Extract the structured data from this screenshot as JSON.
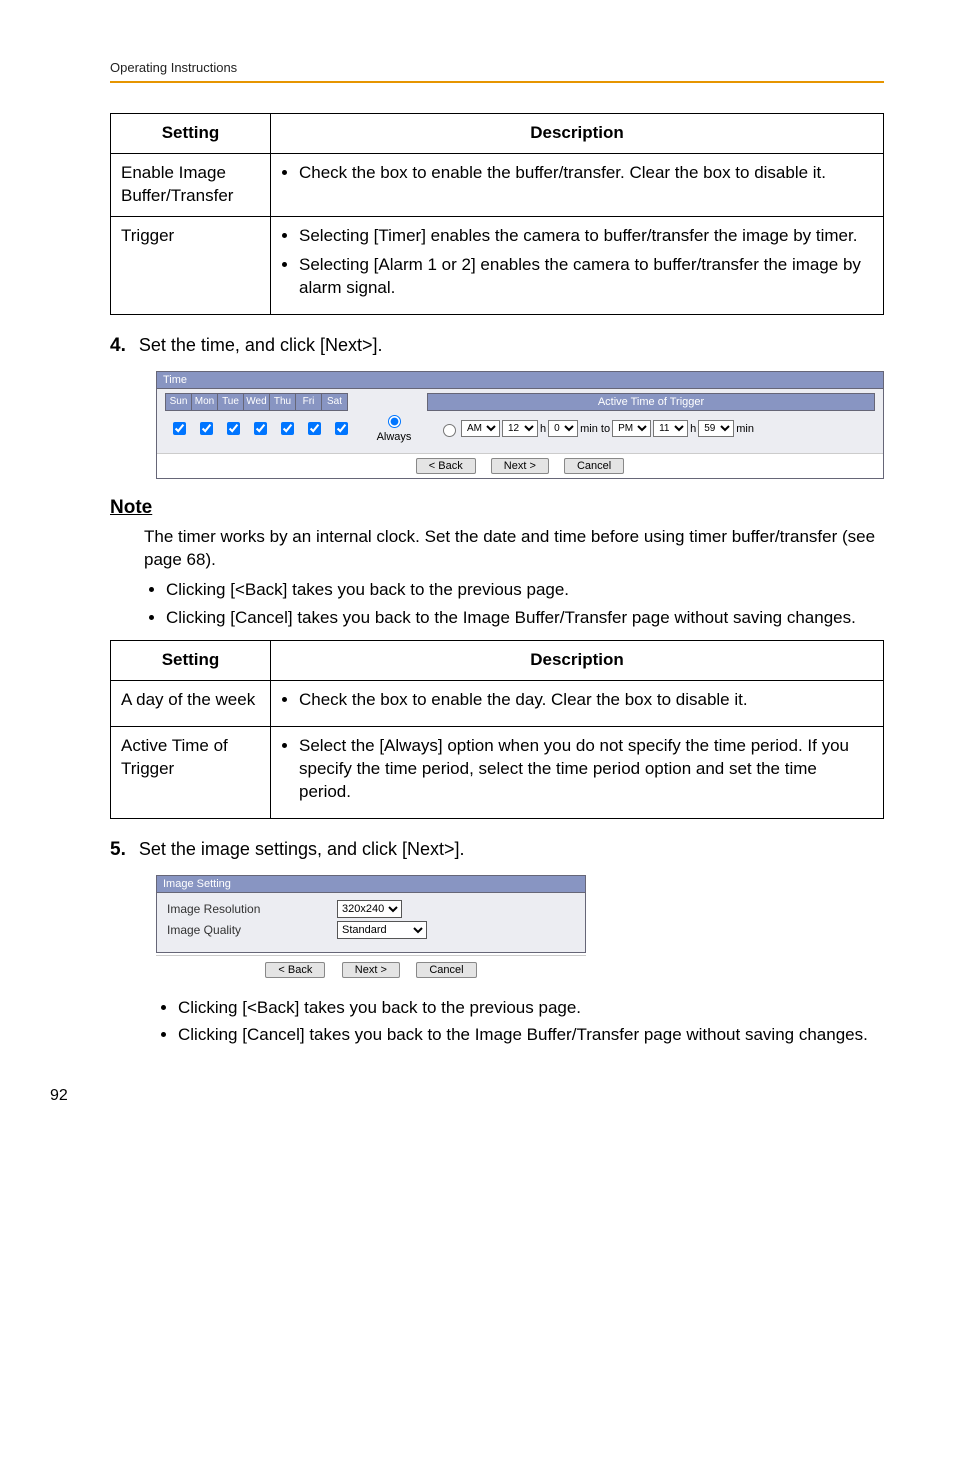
{
  "header": {
    "text": "Operating Instructions"
  },
  "page_number": "92",
  "table1": {
    "head_setting": "Setting",
    "head_desc": "Description",
    "rows": [
      {
        "setting": "Enable Image Buffer/Transfer",
        "bullets": [
          "Check the box to enable the buffer/transfer. Clear the box to disable it."
        ]
      },
      {
        "setting": "Trigger",
        "bullets": [
          "Selecting [Timer] enables the camera to buffer/transfer the image by timer.",
          "Selecting [Alarm 1 or 2] enables the camera to buffer/transfer the image by alarm signal."
        ]
      }
    ]
  },
  "step4": {
    "num": "4.",
    "text": "Set the time, and click [Next>]."
  },
  "time_panel": {
    "title": "Time",
    "days": [
      "Sun",
      "Mon",
      "Tue",
      "Wed",
      "Thu",
      "Fri",
      "Sat"
    ],
    "active_header": "Active Time of Trigger",
    "always_label": "Always",
    "range": {
      "ampm1": "AM",
      "h1": "12",
      "m1": "0",
      "to_label_1": "h",
      "to_label_2": "min to",
      "ampm2": "PM",
      "h2": "11",
      "m2": "59",
      "suffix_1": "h",
      "suffix_2": "min"
    },
    "btn_back": "< Back",
    "btn_next": "Next >",
    "btn_cancel": "Cancel"
  },
  "note": {
    "heading": "Note",
    "para": "The timer works by an internal clock. Set the date and time before using timer buffer/transfer (see page 68).",
    "bullets": [
      "Clicking [<Back] takes you back to the previous page.",
      "Clicking [Cancel] takes you back to the Image Buffer/Transfer page without saving changes."
    ]
  },
  "table2": {
    "head_setting": "Setting",
    "head_desc": "Description",
    "rows": [
      {
        "setting": "A day of the week",
        "bullets": [
          "Check the box to enable the day. Clear the box to disable it."
        ]
      },
      {
        "setting": "Active Time of Trigger",
        "bullets": [
          "Select the [Always] option when you do not specify the time period. If you specify the time period, select the time period option and set the time period."
        ]
      }
    ]
  },
  "step5": {
    "num": "5.",
    "text": "Set the image settings, and click [Next>]."
  },
  "image_panel": {
    "title": "Image Setting",
    "res_label": "Image Resolution",
    "res_value": "320x240",
    "qual_label": "Image Quality",
    "qual_value": "Standard",
    "btn_back": "< Back",
    "btn_next": "Next >",
    "btn_cancel": "Cancel"
  },
  "post_bullets": [
    "Clicking [<Back] takes you back to the previous page.",
    "Clicking [Cancel] takes you back to the Image Buffer/Transfer page without saving changes."
  ]
}
